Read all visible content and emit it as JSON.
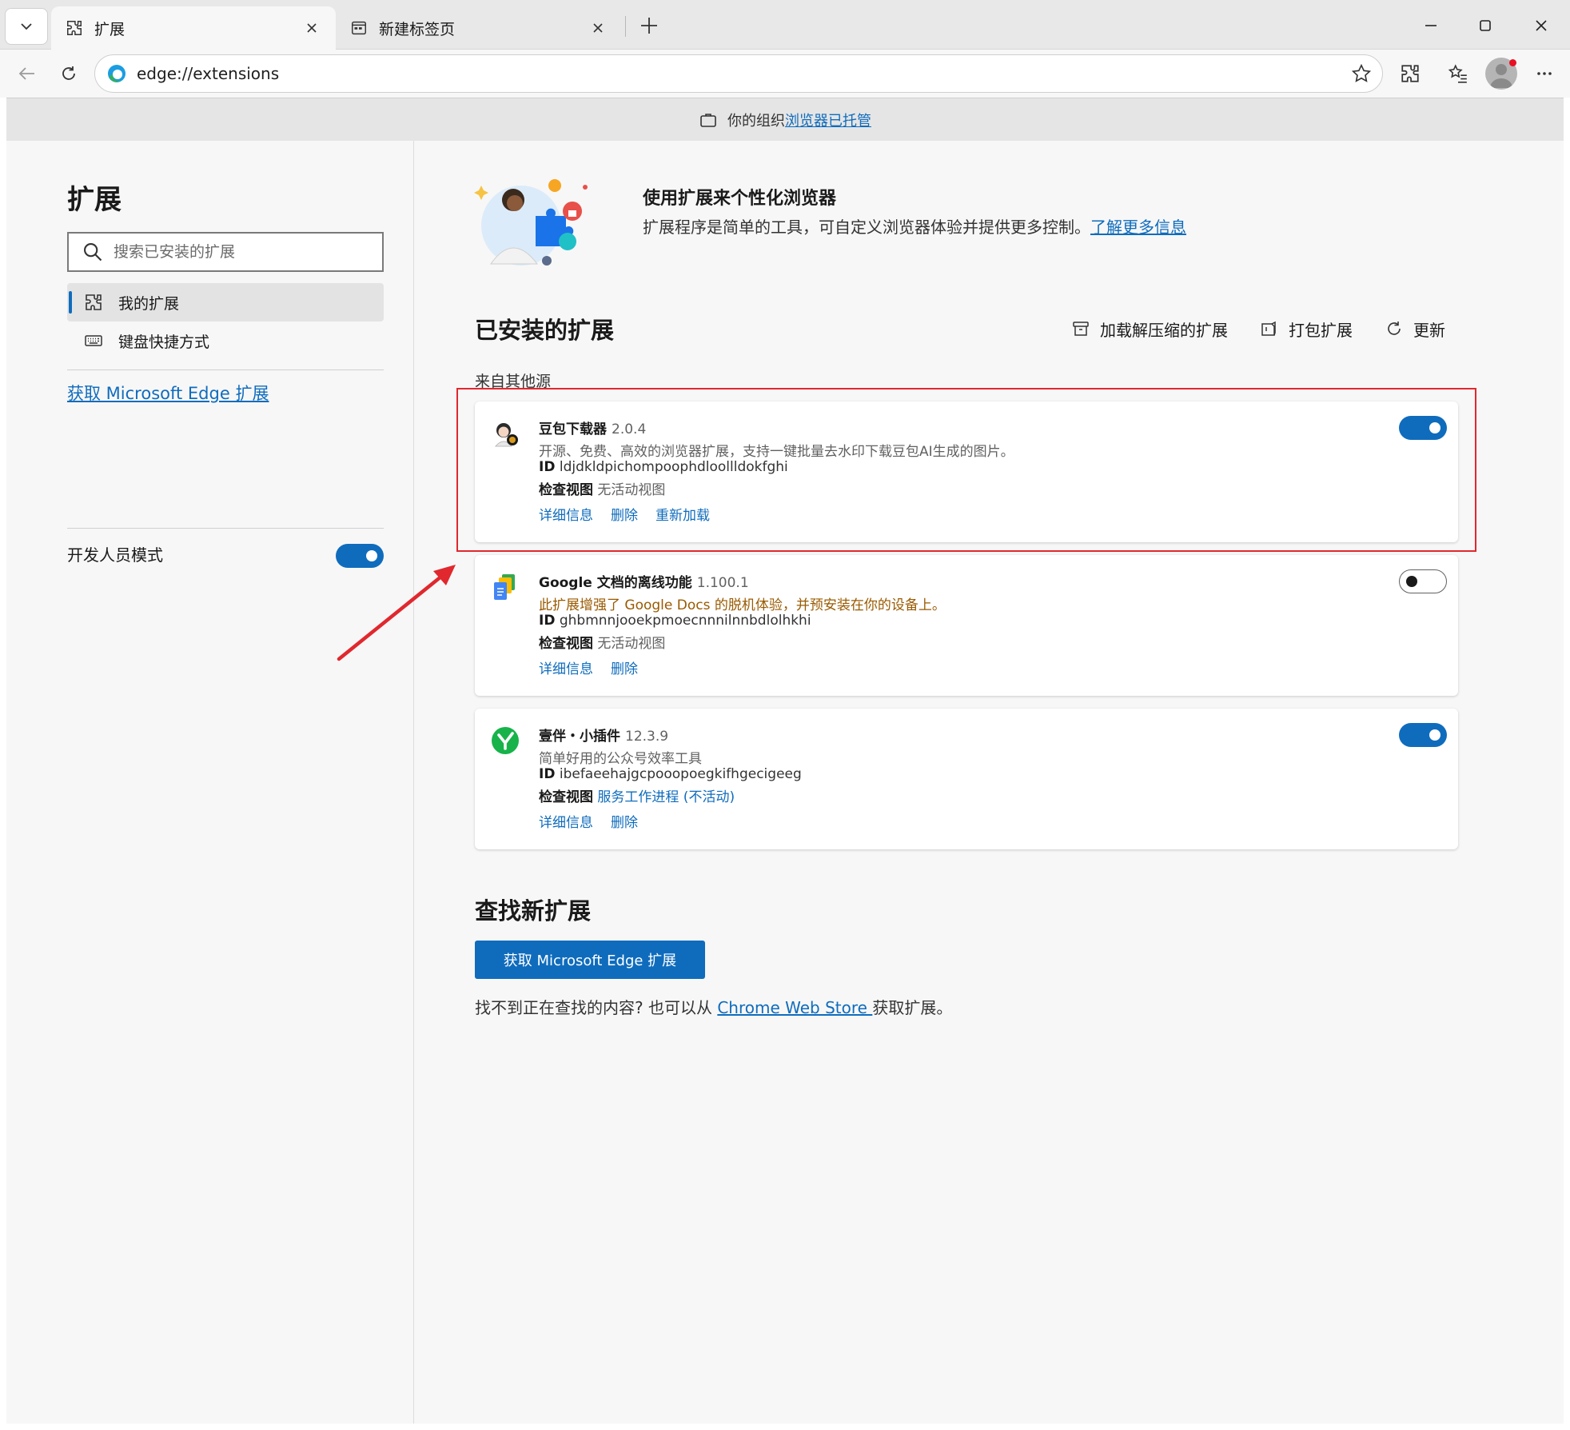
{
  "tabs": [
    {
      "title": "扩展",
      "icon": "puzzle-icon",
      "active": true
    },
    {
      "title": "新建标签页",
      "icon": "newtab-icon",
      "active": false
    }
  ],
  "toolbar": {
    "address": "edge://extensions"
  },
  "managed_banner": {
    "text": "你的组织",
    "link": "浏览器已托管"
  },
  "sidebar": {
    "title": "扩展",
    "search_placeholder": "搜索已安装的扩展",
    "items": [
      {
        "label": "我的扩展",
        "icon": "puzzle-icon",
        "selected": true
      },
      {
        "label": "键盘快捷方式",
        "icon": "keyboard-icon",
        "selected": false
      }
    ],
    "store_link": "获取 Microsoft Edge 扩展",
    "dev_mode_label": "开发人员模式",
    "dev_mode_on": true
  },
  "hero": {
    "title": "使用扩展来个性化浏览器",
    "desc": "扩展程序是简单的工具，可自定义浏览器体验并提供更多控制。",
    "link": "了解更多信息"
  },
  "installed": {
    "title": "已安装的扩展",
    "actions": [
      {
        "label": "加载解压缩的扩展",
        "icon": "archive-icon"
      },
      {
        "label": "打包扩展",
        "icon": "package-icon"
      },
      {
        "label": "更新",
        "icon": "refresh-icon"
      }
    ],
    "source_label": "来自其他源",
    "id_label": "ID",
    "inspect_label": "检查视图",
    "extensions": [
      {
        "name": "豆包下载器",
        "version": "2.0.4",
        "desc": "开源、免费、高效的浏览器扩展，支持一键批量去水印下载豆包AI生成的图片。",
        "id": "ldjdkldpichompoophdloollldokfghi",
        "inspect": "无活动视图",
        "links": [
          "详细信息",
          "删除",
          "重新加载"
        ],
        "enabled": true
      },
      {
        "name": "Google 文档的离线功能",
        "version": "1.100.1",
        "desc": "此扩展增强了 Google Docs 的脱机体验，并预安装在你的设备上。",
        "id": "ghbmnnjooekpmoecnnnilnnbdlolhkhi",
        "inspect": "无活动视图",
        "links": [
          "详细信息",
          "删除"
        ],
        "enabled": false
      },
      {
        "name": "壹伴・小插件",
        "version": "12.3.9",
        "desc": "简单好用的公众号效率工具",
        "id": "ibefaeehajgcpooopoegkifhgecigeeg",
        "inspect": "服务工作进程 (不活动)",
        "links": [
          "详细信息",
          "删除"
        ],
        "enabled": true
      }
    ]
  },
  "find": {
    "title": "查找新扩展",
    "button": "获取 Microsoft Edge 扩展",
    "desc_prefix": "找不到正在查找的内容? 也可以从 ",
    "link": "Chrome Web Store ",
    "desc_suffix": "获取扩展。"
  },
  "colors": {
    "accent": "#0f6cbd",
    "annotation_red": "#e0282e"
  }
}
